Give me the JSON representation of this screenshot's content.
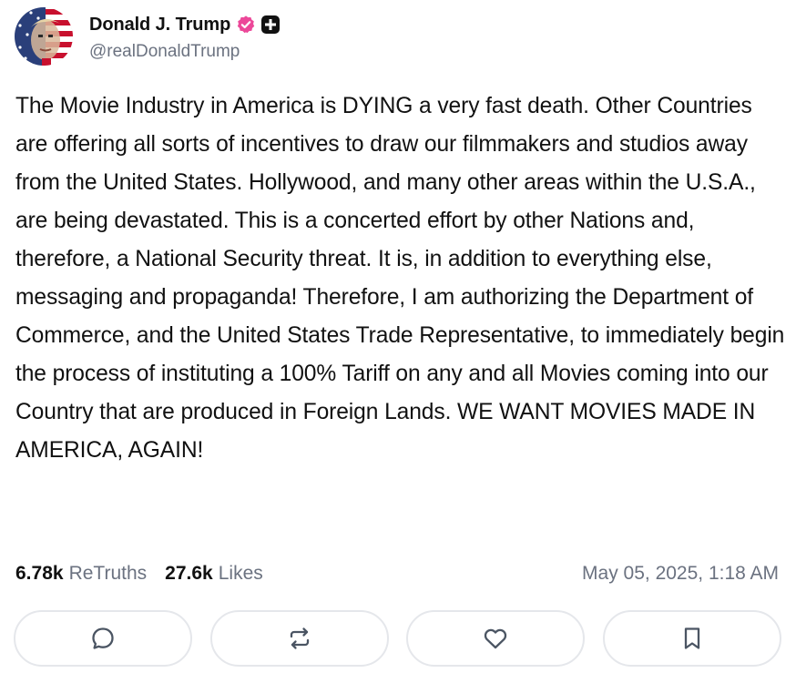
{
  "author": {
    "display_name": "Donald J. Trump",
    "handle": "@realDonaldTrump",
    "verified_icon": "verified-badge-icon",
    "plus_icon": "plus-square-icon"
  },
  "post": {
    "text": "The Movie Industry in America is DYING a very fast death. Other Countries are offering all sorts of incentives to draw our filmmakers and studios away from the United States. Hollywood, and many other areas within the U.S.A., are being devastated. This is a concerted effort by other Nations and, therefore, a National Security threat. It is, in addition to everything else, messaging and propaganda! Therefore, I am authorizing the Department of Commerce, and the United States Trade Representative, to immediately begin the process of instituting a 100% Tariff on any and all Movies coming into our Country that are produced in Foreign Lands. WE WANT MOVIES MADE IN AMERICA, AGAIN!"
  },
  "stats": {
    "retruths_count": "6.78k",
    "retruths_label": "ReTruths",
    "likes_count": "27.6k",
    "likes_label": "Likes",
    "timestamp": "May 05, 2025, 1:18 AM"
  },
  "actions": [
    {
      "icon": "reply-icon"
    },
    {
      "icon": "retruth-icon"
    },
    {
      "icon": "like-heart-icon"
    },
    {
      "icon": "bookmark-icon"
    }
  ],
  "colors": {
    "verified_badge": "#ec4899",
    "muted_text": "#6b7280",
    "button_border": "#e5e7eb",
    "icon_gray": "#4b5563"
  }
}
